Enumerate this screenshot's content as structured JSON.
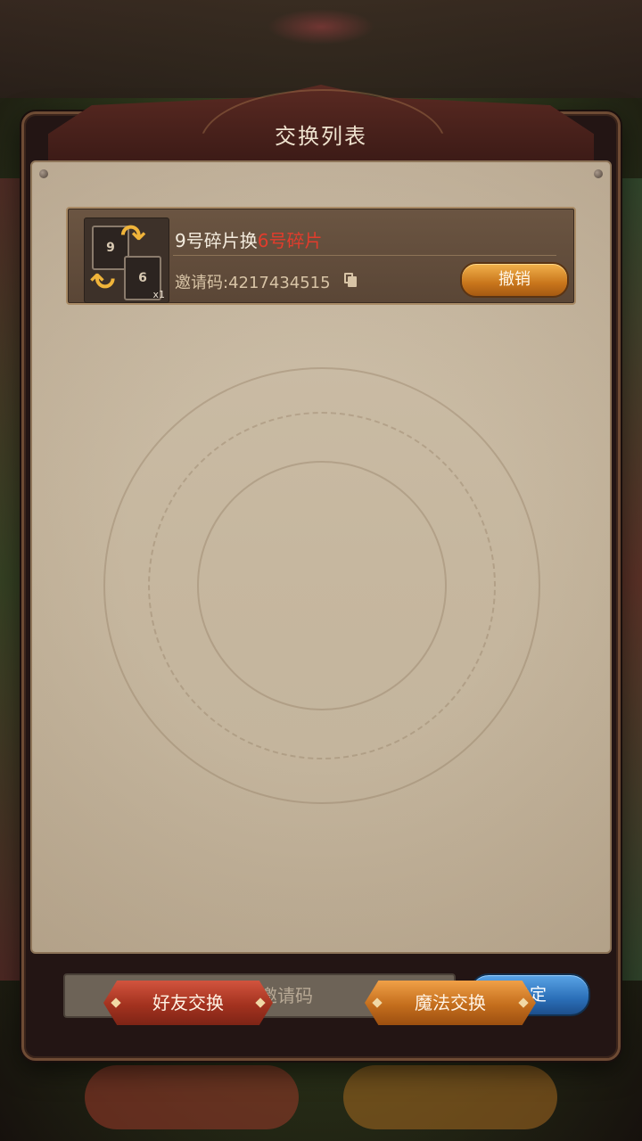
{
  "dialog": {
    "title": "交换列表"
  },
  "exchange_list": [
    {
      "title_prefix": "9号碎片换",
      "title_highlight": "6号碎片",
      "invite_label": "邀请码:4217434515",
      "give_card": "9",
      "get_card": "6",
      "count": "x1",
      "cancel_label": "撤销"
    }
  ],
  "invite_input": {
    "placeholder": "请输入邀请码",
    "value": ""
  },
  "confirm_label": "确定",
  "bottom_tabs": {
    "friend_label": "好友交换",
    "magic_label": "魔法交换"
  },
  "colors": {
    "highlight": "#e23c2c",
    "cancel_button": "#c9761c",
    "confirm_button": "#2b6fb8",
    "friend_button": "#a3321f",
    "magic_button": "#c46e1d"
  }
}
